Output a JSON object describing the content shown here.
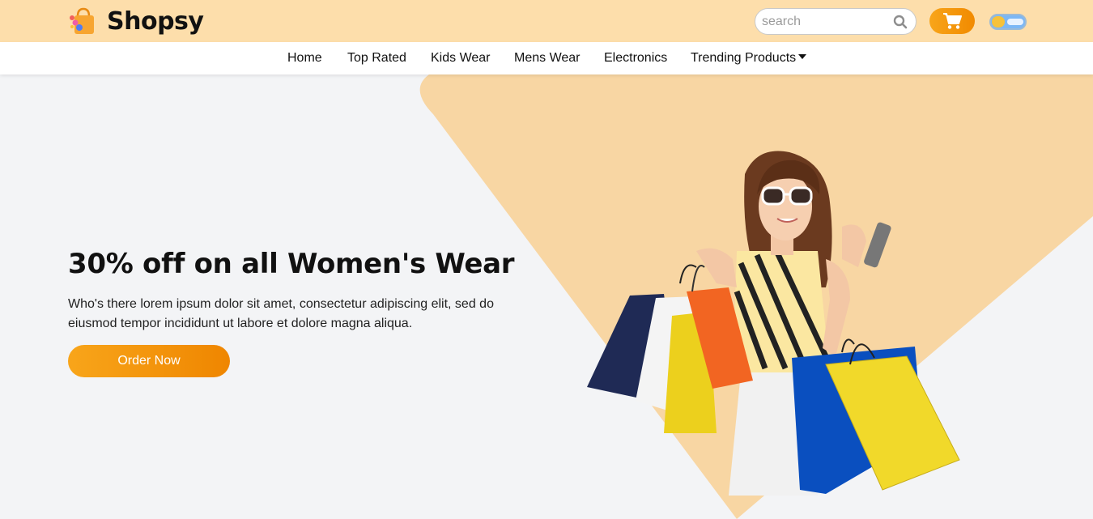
{
  "header": {
    "brand": "Shopsy",
    "logo_icon": "shopping-bag-icon",
    "search": {
      "placeholder": "search",
      "icon": "search-icon"
    },
    "cart": {
      "icon": "cart-icon"
    },
    "theme_toggle": {
      "icon": "sun-cloud-toggle",
      "state": "light"
    }
  },
  "nav": {
    "items": [
      {
        "label": "Home"
      },
      {
        "label": "Top Rated"
      },
      {
        "label": "Kids Wear"
      },
      {
        "label": "Mens Wear"
      },
      {
        "label": "Electronics"
      },
      {
        "label": "Trending Products",
        "icon": "caret-down-icon"
      }
    ]
  },
  "hero": {
    "title": "30% off on all Women's Wear",
    "description": "Who's there lorem ipsum dolor sit amet, consectetur adipiscing elit, sed do eiusmod tempor incididunt ut labore et dolore magna aliqua.",
    "cta_label": "Order Now",
    "image_icon": "woman-with-shopping-bags-image"
  },
  "colors": {
    "header_bg": "#fddeab",
    "accent": "#f8a51a",
    "hero_bg": "#f3f4f6",
    "hero_shape": "#f8d6a3"
  }
}
